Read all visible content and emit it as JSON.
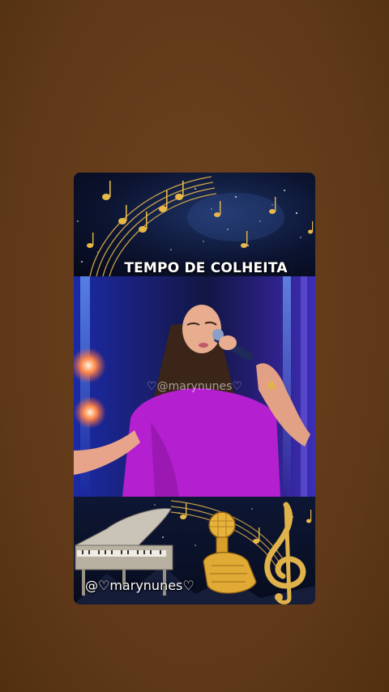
{
  "top_banner": {
    "title": "TEMPO DE COLHEITA"
  },
  "video": {
    "watermark": "♡@marynunes♡"
  },
  "bottom_banner": {
    "handle": "@♡marynunes♡"
  },
  "colors": {
    "background": "#5e3818",
    "gold": "#e0b24a",
    "dress": "#b41fd0"
  },
  "icons": [
    "music-note-icon",
    "treble-clef-icon",
    "microphone-icon",
    "piano-icon"
  ]
}
